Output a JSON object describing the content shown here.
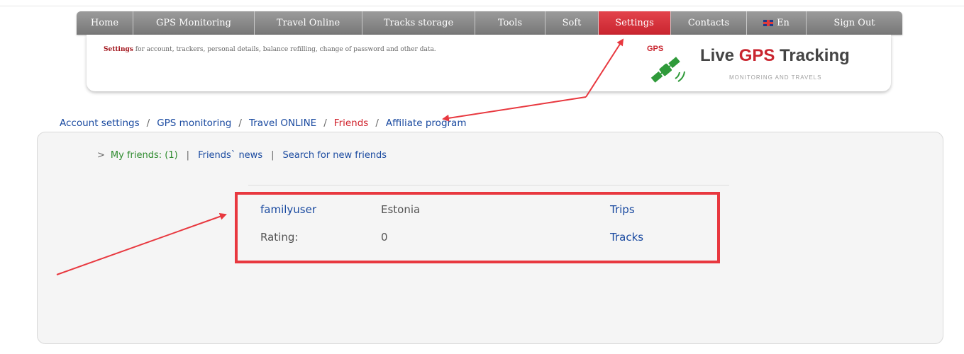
{
  "nav": {
    "items": [
      {
        "label": "Home"
      },
      {
        "label": "GPS Monitoring"
      },
      {
        "label": "Travel Online"
      },
      {
        "label": "Tracks storage"
      },
      {
        "label": "Tools"
      },
      {
        "label": "Soft"
      },
      {
        "label": "Settings",
        "active": true
      },
      {
        "label": "Contacts"
      },
      {
        "label": "En",
        "icon": "uk-flag-icon"
      },
      {
        "label": "Sign Out"
      }
    ]
  },
  "header": {
    "desc_strong": "Settings",
    "desc_rest": " for account, trackers, personal details, balance refilling, change of password and other data.",
    "logo": {
      "gps_badge": "GPS",
      "title_part1": "Live ",
      "title_part2": "GPS",
      "title_part3": " Tracking",
      "subtitle": "MONITORING AND TRAVELS"
    }
  },
  "subnav": {
    "items": [
      {
        "label": "Account settings"
      },
      {
        "label": "GPS monitoring"
      },
      {
        "label": "Travel ONLINE"
      },
      {
        "label": "Friends",
        "active": true
      },
      {
        "label": "Affiliate program"
      }
    ],
    "separator": "/"
  },
  "friends": {
    "chevron": ">",
    "my_friends": "My friends: (1)",
    "separator": "|",
    "news": "Friends` news",
    "search": "Search for new friends",
    "list": [
      {
        "username": "familyuser",
        "country": "Estonia",
        "trips_label": "Trips",
        "rating_label": "Rating:",
        "rating_value": "0",
        "tracks_label": "Tracks"
      }
    ]
  },
  "colors": {
    "accent_red": "#c9252f",
    "link_blue": "#1a4aa0",
    "nav_gray": "#888888",
    "highlight_red": "#e8383f",
    "my_friends_green": "#2e8b2e"
  }
}
